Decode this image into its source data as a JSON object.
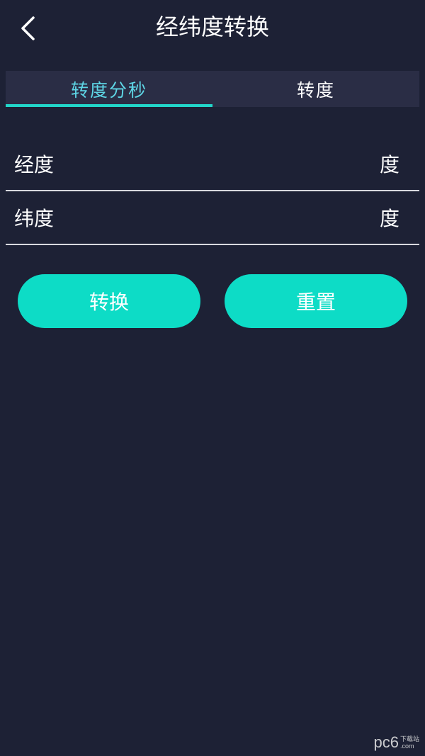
{
  "header": {
    "title": "经纬度转换",
    "back_icon": "chevron-left-icon"
  },
  "tabs": [
    {
      "label": "转度分秒",
      "active": true
    },
    {
      "label": "转度",
      "active": false
    }
  ],
  "fields": [
    {
      "label": "经度",
      "unit": "度",
      "value": "",
      "placeholder": ""
    },
    {
      "label": "纬度",
      "unit": "度",
      "value": "",
      "placeholder": ""
    }
  ],
  "buttons": {
    "convert_label": "转换",
    "reset_label": "重置"
  },
  "watermark": {
    "main": "pc6",
    "sub": "下载站",
    "domain": ".com"
  },
  "colors": {
    "background": "#1d2135",
    "tab_bar": "#2a2d45",
    "accent": "#0ddcc6",
    "active_tab_text": "#5ed6e6"
  }
}
